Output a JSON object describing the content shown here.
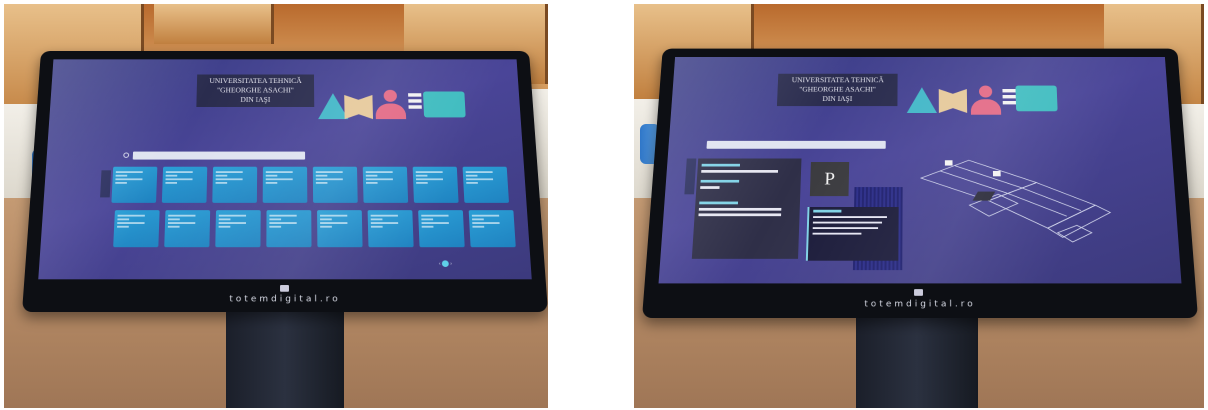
{
  "photos": [
    {
      "id": "tile-list",
      "screen": {
        "title_lines": [
          "UNIVERSITATEA TEHNICĂ",
          "\"GHEORGHE ASACHI\"",
          "DIN IAŞI"
        ],
        "tile_rows": 2,
        "tiles_per_row": 8
      },
      "brand": "totemdigital.ro"
    },
    {
      "id": "room-detail",
      "screen": {
        "title_lines": [
          "UNIVERSITATEA TEHNICĂ",
          "\"GHEORGHE ASACHI\"",
          "DIN IAŞI"
        ],
        "detail_letter": "P"
      },
      "brand": "totemdigital.ro"
    }
  ],
  "colors": {
    "screen_bg": "#4a4598",
    "tile": "#2b9fd6",
    "logo_triangle": "#43b7c8",
    "logo_book": "#e6c99b",
    "logo_person": "#e36a86",
    "logo_bubble": "#3fbcc0"
  },
  "icons": [
    "search-icon",
    "home-icon"
  ]
}
